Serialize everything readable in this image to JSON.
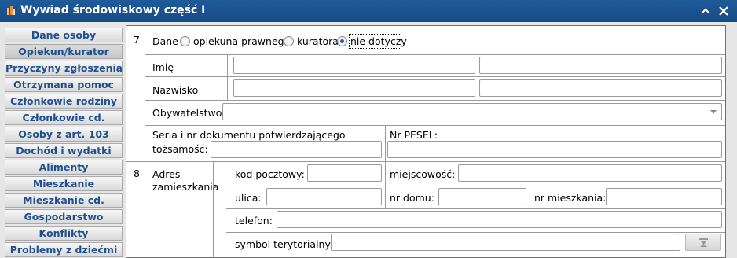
{
  "window": {
    "title": "Wywiad środowiskowy część I"
  },
  "nav": [
    "Dane osoby",
    "Opiekun/kurator",
    "Przyczyny zgłoszenia",
    "Otrzymana pomoc",
    "Członkowie rodziny",
    "Członkowie cd.",
    "Osoby z art. 103",
    "Dochód i wydatki",
    "Alimenty",
    "Mieszkanie",
    "Mieszkanie cd.",
    "Gospodarstwo",
    "Konflikty",
    "Problemy z dziećmi"
  ],
  "nav_active": "Opiekun/kurator",
  "section7": {
    "number": "7",
    "dane_label": "Dane",
    "radio_options": [
      "opiekuna prawnego",
      "kuratora",
      "nie dotyczy"
    ],
    "selected": "nie dotyczy",
    "imie_label": "Imię",
    "nazwisko_label": "Nazwisko",
    "obywatelstwo_label": "Obywatelstwo",
    "seria_label_line1": "Seria i nr dokumentu potwierdzającego",
    "seria_label_line2": "tożsamość:",
    "pesel_label": "Nr PESEL:"
  },
  "section8": {
    "number": "8",
    "adres_line1": "Adres",
    "adres_line2": "zamieszkania",
    "kod_label": "kod pocztowy:",
    "miejscowosc_label": "miejscowość:",
    "ulica_label": "ulica:",
    "nr_domu_label": "nr domu:",
    "nr_mieszkania_label": "nr mieszkania:",
    "telefon_label": "telefon:",
    "symbol_label": "symbol terytorialny:"
  },
  "icons": {
    "app": "app-icon",
    "collapse": "chevron-up-icon",
    "close": "close-icon",
    "picker": "dropdown-picker-icon"
  }
}
